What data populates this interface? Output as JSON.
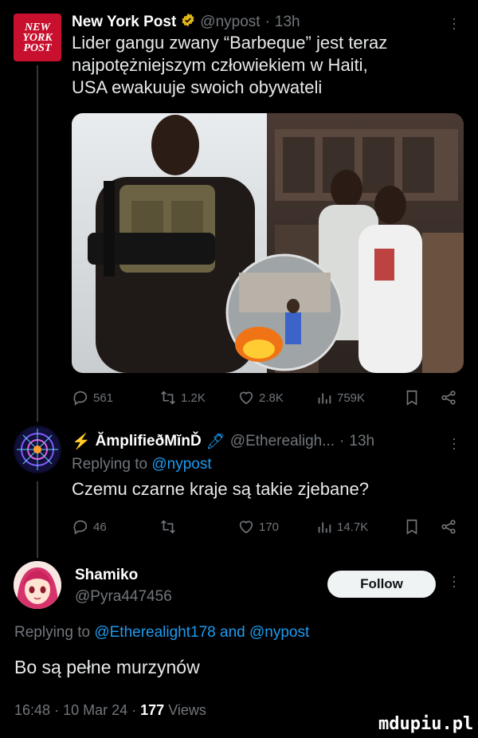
{
  "tweet1": {
    "author": "New York Post",
    "handle": "@nypost",
    "time": "13h",
    "logo_lines": [
      "NEW",
      "YORK",
      "POST"
    ],
    "text_lines": [
      "Lider gangu zwany “Barbeque” jest teraz",
      "najpotężniejszym człowiekiem w Haiti,",
      "USA ewakuuje swoich obywateli"
    ],
    "stats": {
      "replies": "561",
      "retweets": "1.2K",
      "likes": "2.8K",
      "views": "759K"
    }
  },
  "tweet2": {
    "author_prefix": "⚡",
    "author": "ĂmplifieðMĭnĎ",
    "author_suffix": "🖊",
    "handle": "@Etherealigh...",
    "time": "13h",
    "replying_label": "Replying to",
    "replying_handle": "@nypost",
    "text": "Czemu czarne kraje są takie zjebane?",
    "stats": {
      "replies": "46",
      "retweets": "",
      "likes": "170",
      "views": "14.7K"
    }
  },
  "tweet3": {
    "author": "Shamiko",
    "handle": "@Pyra447456",
    "follow_label": "Follow",
    "replying_label": "Replying to",
    "replying_handle_1": "@Etherealight178",
    "replying_and": "and",
    "replying_handle_2": "@nypost",
    "text": "Bo są pełne murzynów",
    "time": "16:48",
    "date": "10 Mar 24",
    "views_count": "177",
    "views_label": "Views"
  },
  "sep": "·",
  "watermark": "mdupiu.pl",
  "colors": {
    "accent": "#1d9bf0",
    "brand_red": "#c8102e",
    "verified_gold": "#e2b719",
    "muted": "#71767b"
  }
}
